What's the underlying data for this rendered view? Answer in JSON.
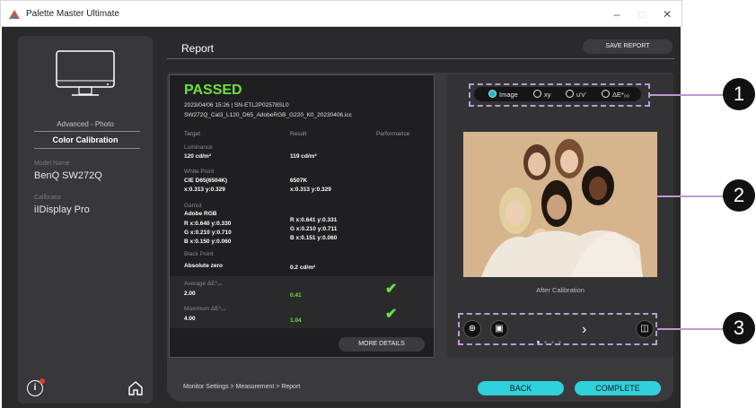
{
  "window": {
    "title": "Palette Master Ultimate",
    "controls": [
      "–",
      "□",
      "✕"
    ]
  },
  "sidebar": {
    "mode": "Advanced - Photo",
    "section": "Color Calibration",
    "model_label": "Model Name",
    "model_value": "BenQ SW272Q",
    "calibrator_label": "Calibrator",
    "calibrator_value": "iIDisplay Pro"
  },
  "header": {
    "title": "Report",
    "save_label": "SAVE REPORT"
  },
  "report": {
    "status": "PASSED",
    "meta_line1": "2023/04/06 15:26 | SN-ETL2P02578SL0",
    "meta_line2": "SW272Q_Cal3_L120_D65_AdobeRGB_G220_K0_20230406.icc",
    "columns": [
      "Target",
      "Result",
      "Performance"
    ],
    "luminance": {
      "label": "Luminance",
      "target": "120 cd/m²",
      "result": "119 cd/m²"
    },
    "white_point": {
      "label": "White Point",
      "target_1": "CIE D65(6504K)",
      "target_2": "x:0.313 y:0.329",
      "result_1": "6507K",
      "result_2": "x:0.313 y:0.329"
    },
    "gamut": {
      "label": "Gamut",
      "target_name": "Adobe RGB",
      "target_r": "R x:0.640 y:0.330",
      "target_g": "G x:0.210 y:0.710",
      "target_b": "B x:0.150 y:0.060",
      "result_r": "R x:0.641 y:0.331",
      "result_g": "G x:0.210 y:0.711",
      "result_b": "B x:0.151 y:0.060"
    },
    "black_point": {
      "label": "Black Point",
      "target": "Absolute zero",
      "result": "0.2 cd/m²"
    },
    "avg_de": {
      "label": "Average ΔE*₀₀",
      "target": "2.00",
      "result": "0.41",
      "perf": "✔"
    },
    "max_de": {
      "label": "Maximum ΔE*₀₀",
      "target": "4.00",
      "result": "1.04",
      "perf": "✔"
    },
    "more_label": "MORE DETAILS"
  },
  "preview": {
    "options": [
      "Image",
      "xy",
      "u'v'",
      "ΔE*₀₀"
    ],
    "selected": "Image",
    "caption": "After Calibration",
    "zoom_icon": "zoom-in-icon",
    "image_icon": "image-icon",
    "compare_icon": "split-compare-icon"
  },
  "callouts": [
    "1",
    "2",
    "3"
  ],
  "footer": {
    "breadcrumb": "Monitor Settings >  Measurement >  Report",
    "back_label": "BACK",
    "complete_label": "COMPLETE"
  },
  "colors": {
    "accent": "#2fd1dc",
    "pass_green": "#6ee03f",
    "callout": "#b99bd0"
  }
}
